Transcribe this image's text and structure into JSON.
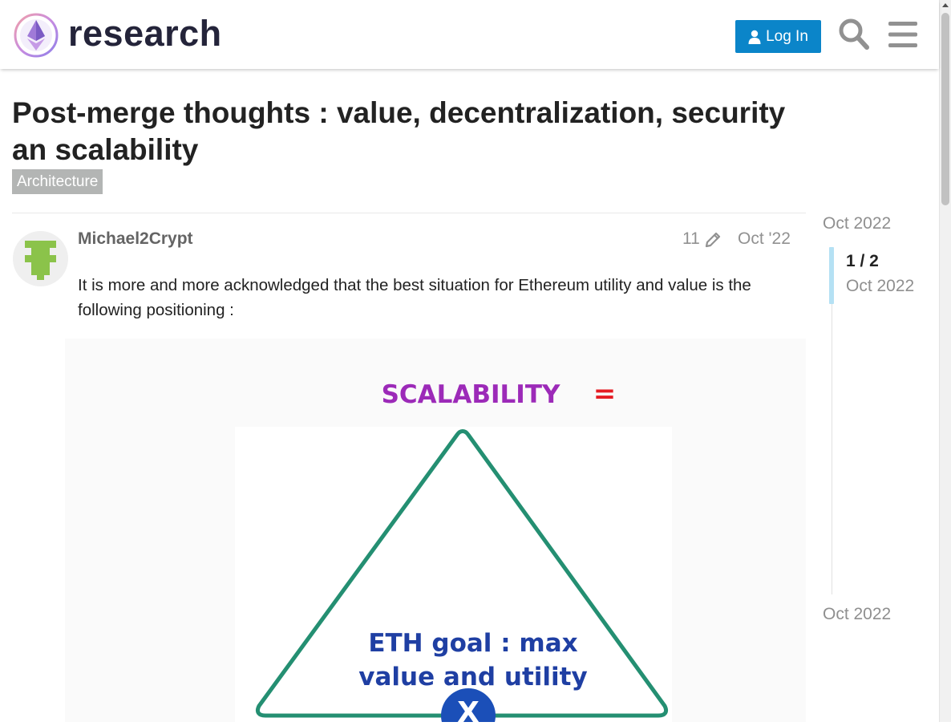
{
  "header": {
    "brand": "research",
    "login_label": "Log In",
    "accent_color": "#0b85c9"
  },
  "topic": {
    "title": "Post-merge thoughts : value, decentralization, security an scalability",
    "category": "Architecture"
  },
  "post": {
    "author": "Michael2Crypt",
    "edit_count": "11",
    "date": "Oct '22",
    "text": "It is more and more acknowledged that the best situation for Ethereum utility and value is the following positioning :",
    "image": {
      "heading": "SCALABILITY",
      "heading_symbol": "=",
      "center_text_line1": "ETH goal : max",
      "center_text_line2": "value and utility",
      "marker": "X"
    }
  },
  "timeline": {
    "start_label": "Oct 2022",
    "counter": "1 / 2",
    "counter_date": "Oct 2022",
    "end_label": "Oct 2022"
  },
  "icons": [
    "ethereum-logo-icon",
    "user-icon",
    "search-icon",
    "menu-icon",
    "pencil-icon",
    "avatar-identicon"
  ]
}
